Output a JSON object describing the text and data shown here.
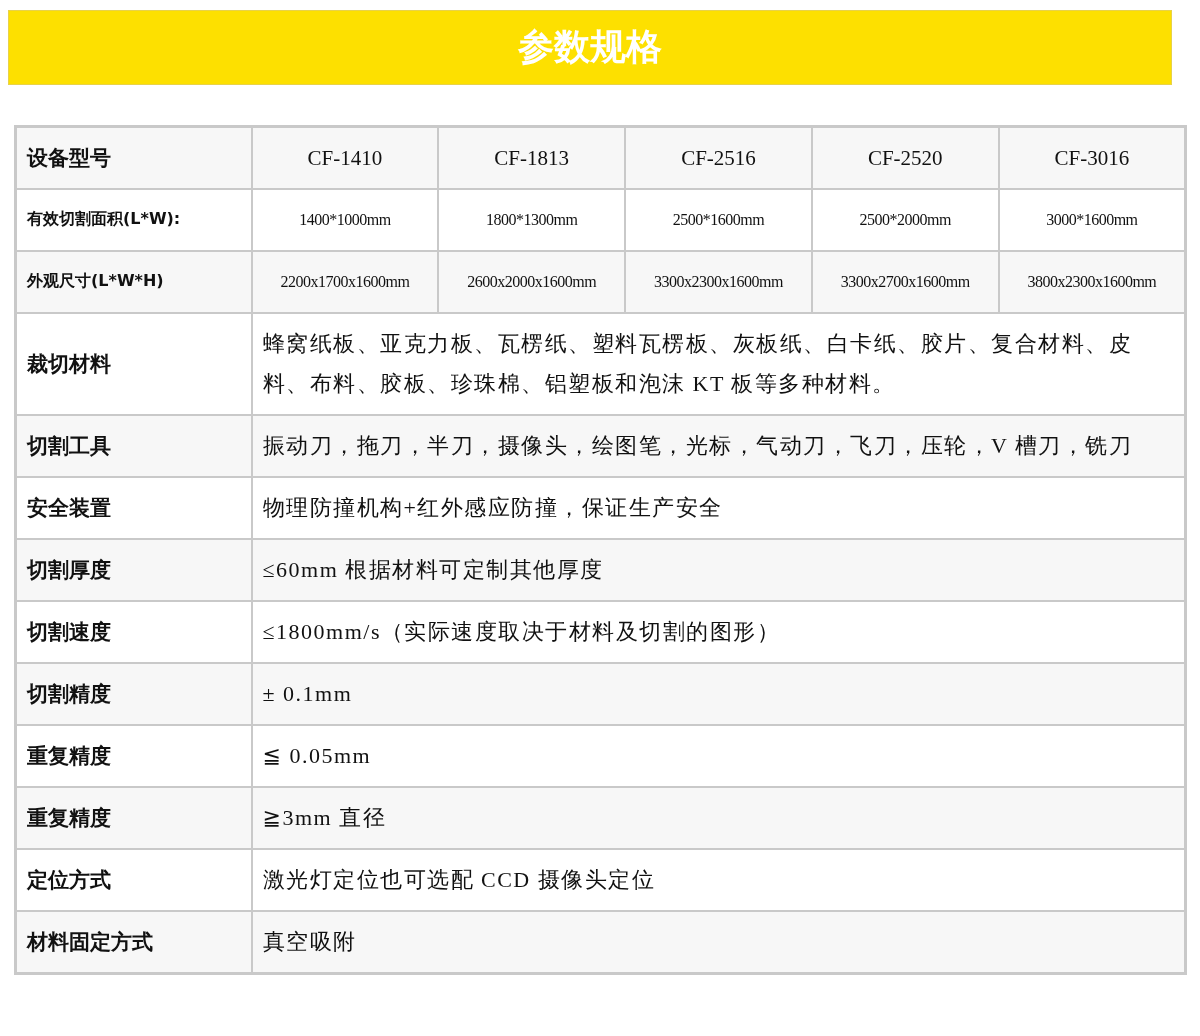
{
  "title": "参数规格",
  "table": {
    "header": {
      "label": "设备型号",
      "models": [
        "CF-1410",
        "CF-1813",
        "CF-2516",
        "CF-2520",
        "CF-3016"
      ]
    },
    "rows": [
      {
        "kind": "per_model",
        "label": "有效切割面积(L*W):",
        "values": [
          "1400*1000mm",
          "1800*1300mm",
          "2500*1600mm",
          "2500*2000mm",
          "3000*1600mm"
        ]
      },
      {
        "kind": "per_model",
        "label": "外观尺寸(L*W*H)",
        "values": [
          "2200x1700x1600mm",
          "2600x2000x1600mm",
          "3300x2300x1600mm",
          "3300x2700x1600mm",
          "3800x2300x1600mm"
        ]
      },
      {
        "kind": "span",
        "label": "裁切材料",
        "value": "蜂窝纸板、亚克力板、瓦楞纸、塑料瓦楞板、灰板纸、白卡纸、胶片、复合材料、皮料、布料、胶板、珍珠棉、铝塑板和泡沫 KT 板等多种材料。"
      },
      {
        "kind": "span",
        "label": "切割工具",
        "value": "振动刀，拖刀，半刀，摄像头，绘图笔，光标，气动刀，飞刀，压轮，V 槽刀，铣刀"
      },
      {
        "kind": "span",
        "label": "安全装置",
        "value": "物理防撞机构+红外感应防撞，保证生产安全"
      },
      {
        "kind": "span",
        "label": "切割厚度",
        "value": "≤60mm 根据材料可定制其他厚度"
      },
      {
        "kind": "span",
        "label": "切割速度",
        "value": "≤1800mm/s（实际速度取决于材料及切割的图形）"
      },
      {
        "kind": "span",
        "label": "切割精度",
        "value": "± 0.1mm"
      },
      {
        "kind": "span",
        "label": "重复精度",
        "value": "≦ 0.05mm"
      },
      {
        "kind": "span",
        "label": "重复精度",
        "value": "≧3mm 直径"
      },
      {
        "kind": "span",
        "label": "定位方式",
        "value": "激光灯定位也可选配 CCD 摄像头定位"
      },
      {
        "kind": "span",
        "label": "材料固定方式",
        "value": "真空吸附"
      }
    ]
  }
}
